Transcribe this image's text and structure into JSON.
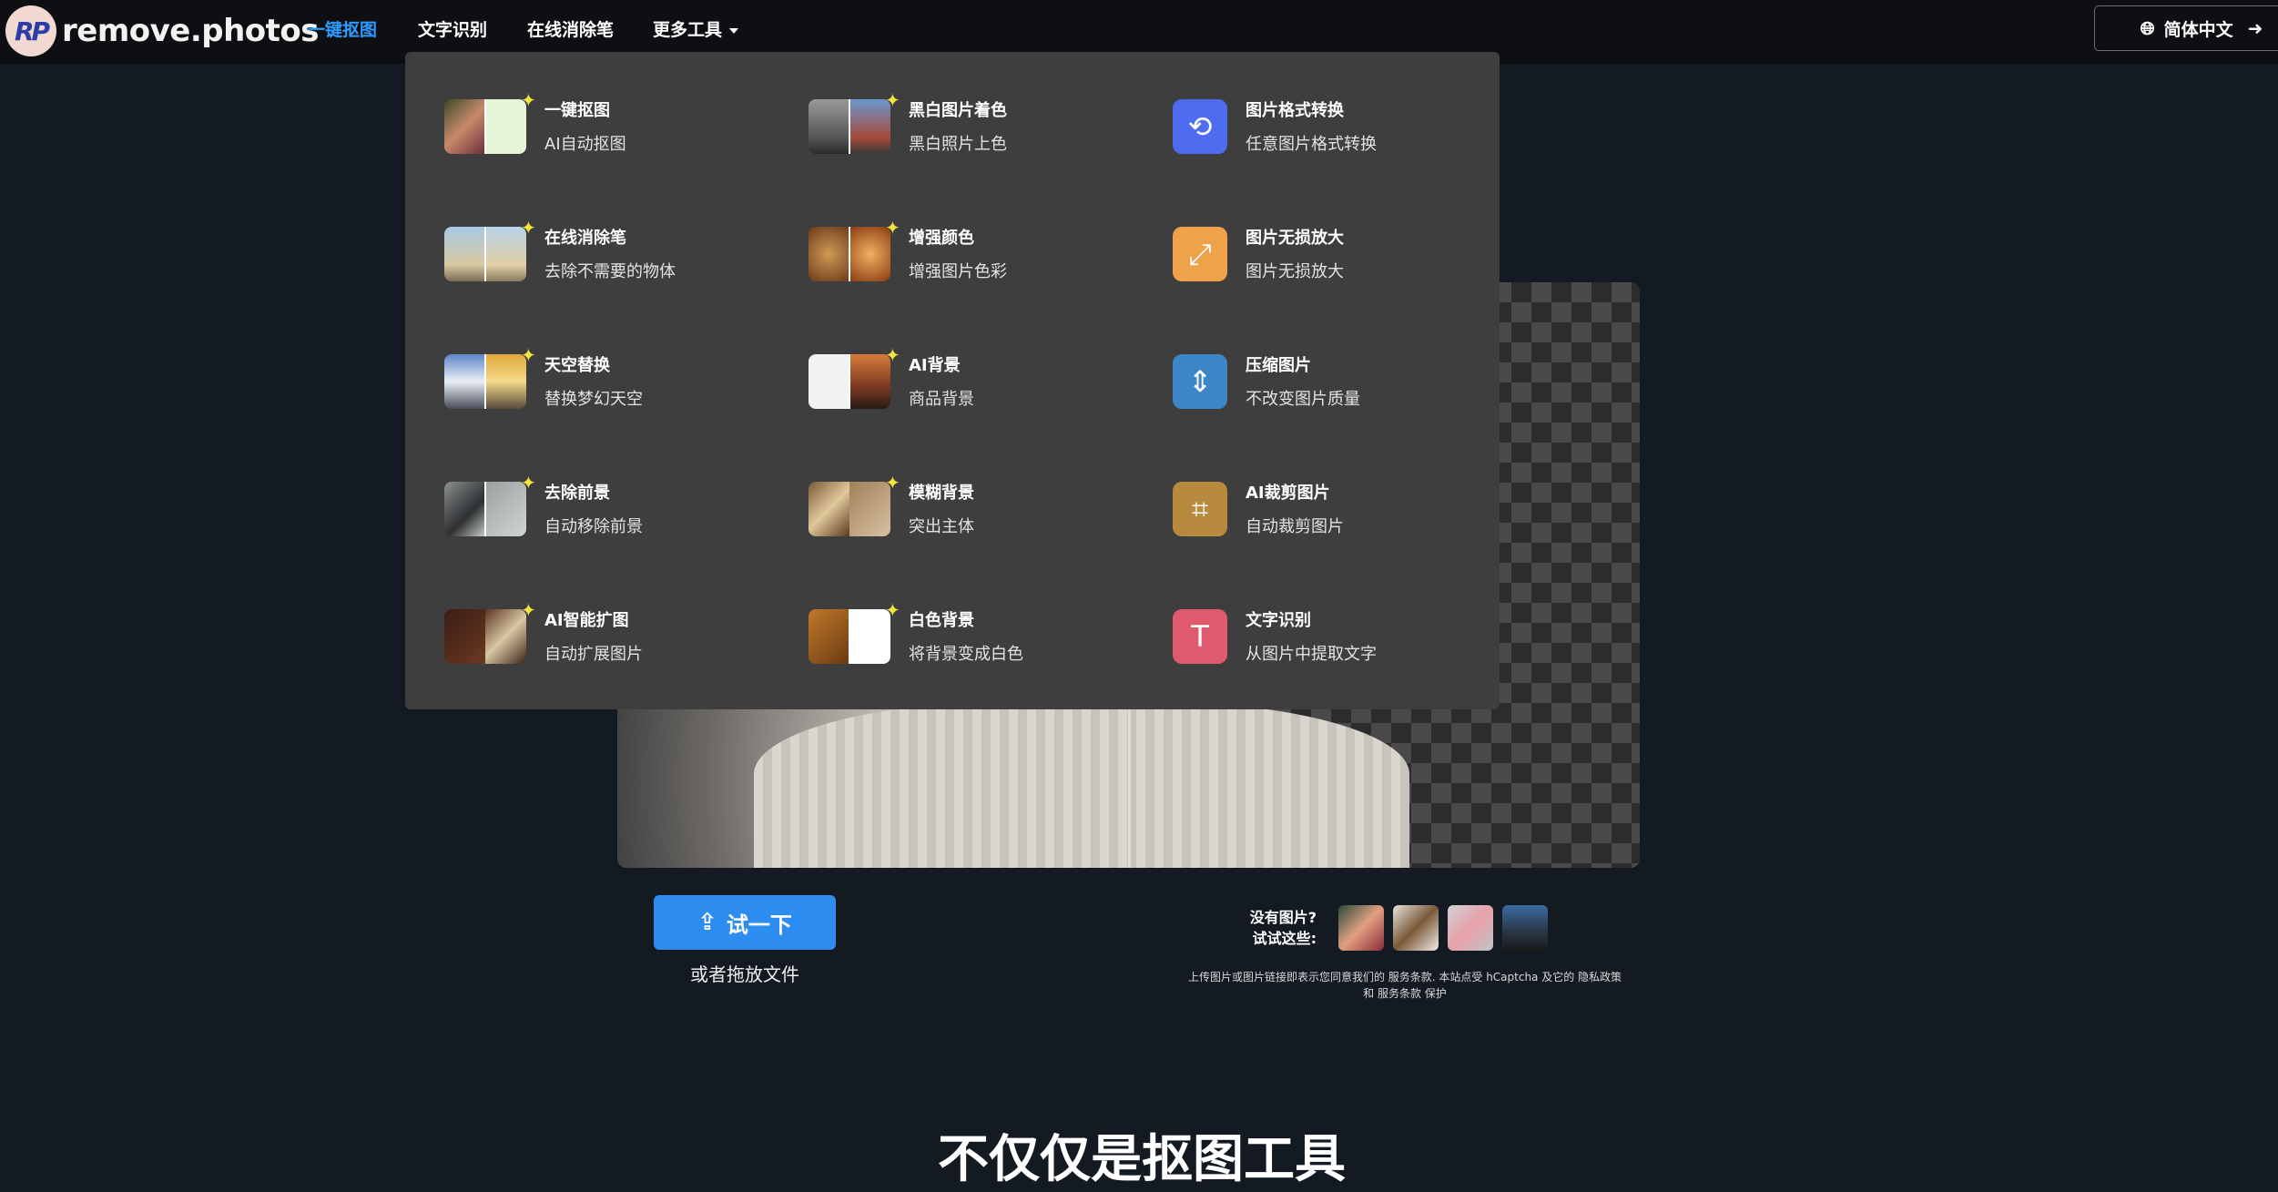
{
  "brand": {
    "name": "remove.photos",
    "badge": "RP"
  },
  "nav": {
    "links": [
      "一键抠图",
      "文字识别",
      "在线消除笔",
      "更多工具"
    ],
    "language": "简体中文"
  },
  "menu": {
    "sparkle": "✦",
    "col1": [
      {
        "title": "一键抠图",
        "sub": "AI自动抠图"
      },
      {
        "title": "在线消除笔",
        "sub": "去除不需要的物体"
      },
      {
        "title": "天空替换",
        "sub": "替换梦幻天空"
      },
      {
        "title": "去除前景",
        "sub": "自动移除前景"
      },
      {
        "title": "AI智能扩图",
        "sub": "自动扩展图片"
      }
    ],
    "col2": [
      {
        "title": "黑白图片着色",
        "sub": "黑白照片上色"
      },
      {
        "title": "增强颜色",
        "sub": "增强图片色彩"
      },
      {
        "title": "AI背景",
        "sub": "商品背景"
      },
      {
        "title": "模糊背景",
        "sub": "突出主体"
      },
      {
        "title": "白色背景",
        "sub": "将背景变成白色"
      }
    ],
    "col3": [
      {
        "title": "图片格式转换",
        "sub": "任意图片格式转换",
        "icon": "⟲",
        "color": "#4f6cf0"
      },
      {
        "title": "图片无损放大",
        "sub": "图片无损放大",
        "icon": "⤢",
        "color": "#f0a24a"
      },
      {
        "title": "压缩图片",
        "sub": "不改变图片质量",
        "icon": "⇕",
        "color": "#3d86c6"
      },
      {
        "title": "AI裁剪图片",
        "sub": "自动裁剪图片",
        "icon": "⌗",
        "color": "#b88a3e"
      },
      {
        "title": "文字识别",
        "sub": "从图片中提取文字",
        "icon": "T",
        "color": "#e05a6e"
      }
    ]
  },
  "upload": {
    "button": "试一下",
    "drop": "或者拖放文件",
    "no_image_line1": "没有图片?",
    "no_image_line2": "试试这些:",
    "terms_line1": "上传图片或图片链接即表示您同意我们的 服务条款. 本站点受 hCaptcha 及它的 隐私政策",
    "terms_line2": "和 服务条款 保护"
  },
  "section": {
    "title": "不仅仅是抠图工具"
  },
  "colors": {
    "accent": "#2d9bff",
    "button": "#2d8cf0",
    "menu_bg": "#3e3e3e"
  }
}
